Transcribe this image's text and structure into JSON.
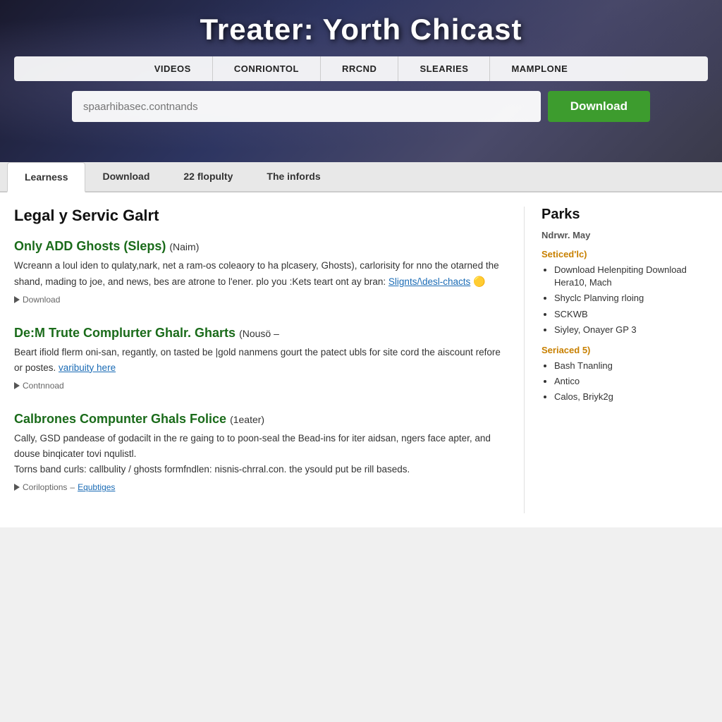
{
  "hero": {
    "title": "Treater: Yorth Chicast",
    "nav": {
      "items": [
        {
          "label": "VIDEOS"
        },
        {
          "label": "CONRIONTOL"
        },
        {
          "label": "RRCND"
        },
        {
          "label": "SLEARIES"
        },
        {
          "label": "MAMPLONE"
        }
      ]
    },
    "search": {
      "placeholder": "spaarhibasec.contnands"
    },
    "download_button": "Download"
  },
  "tabs": {
    "items": [
      {
        "label": "Learness",
        "active": true
      },
      {
        "label": "Download",
        "active": false
      },
      {
        "label": "22 flopulty",
        "active": false
      },
      {
        "label": "The infords",
        "active": false
      }
    ]
  },
  "main": {
    "section_title": "Legal y Servic Galrt",
    "articles": [
      {
        "title": "Only ADD Ghosts (Sleps)",
        "badge": "(Naim)",
        "body": "Wcreann a loul iden to qulaty,nark, net a ram-os coleaory to ha plcasery, Ghosts), carlorisity for nno the otarned the shand, mading to joe, and news, bes are atrone to l'ener. plo you :Kets teart ont ay bran:",
        "link1_text": "Slignts/\\desl-chacts",
        "link1_href": "#",
        "emoji": "🟡",
        "meta_label": "Download"
      },
      {
        "title": "De:M Trute Complurter Ghalr. Gharts",
        "badge": "(Nousö –",
        "body": "Beart ifiold flerm oni-san, regantly, on tasted be |gold nanmens gourt the patect ubls for site cord the aiscount refore or postes.",
        "link1_text": "varibuity here",
        "link1_href": "#",
        "meta_label": "Contnnoad"
      },
      {
        "title": "Calbrones Compunter Ghals Folice",
        "badge": "(1eater)",
        "body": "Cally, GSD pandease of godacilt in the re gaing to to poon-seal the Bead-ins for iter aidsan, ngers face apter, and douse binqicater tovi nqulistl.\nTorns band curls:  callbulity / ghosts formfndlen: nisnis-chrral.con. the ysould put be rill baseds.",
        "link2_text": "callbulity",
        "link3_text": "ghosts formfndlen",
        "link4_text": "nisnis-chrral.con",
        "meta_label": "Coriloptions",
        "meta_link": "Equbtiges"
      }
    ]
  },
  "sidebar": {
    "title": "Parks",
    "subtitle": "Ndrwr. May",
    "sections": [
      {
        "label": "Seticed'lc)",
        "items": [
          "Download Helenpiting Download Hera10, Mach",
          "Shyclc Planving rloing",
          "SCKWB",
          "Siyley, Onayer GP 3"
        ]
      },
      {
        "label": "Seriaced 5)",
        "items": [
          "Bash Tnanling",
          "Antico",
          "Calos, Briyk2g"
        ]
      }
    ]
  }
}
